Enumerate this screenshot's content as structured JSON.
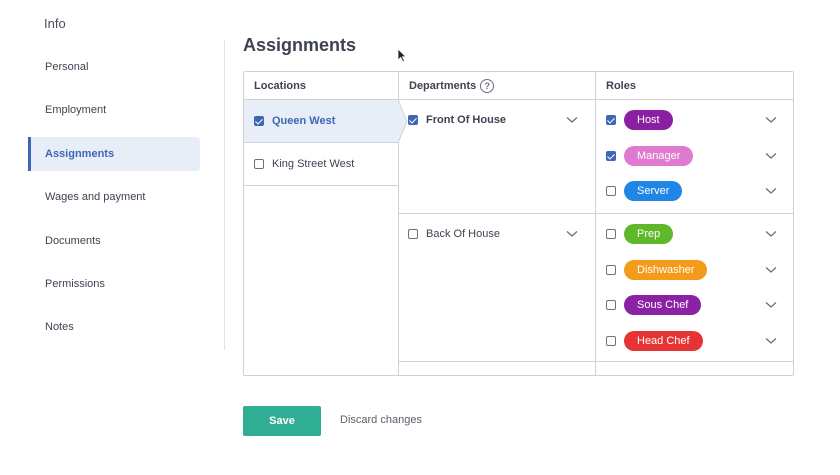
{
  "sidebar": {
    "title": "Info",
    "items": [
      {
        "label": "Personal",
        "active": false
      },
      {
        "label": "Employment",
        "active": false
      },
      {
        "label": "Assignments",
        "active": true
      },
      {
        "label": "Wages and payment",
        "active": false
      },
      {
        "label": "Documents",
        "active": false
      },
      {
        "label": "Permissions",
        "active": false
      },
      {
        "label": "Notes",
        "active": false
      }
    ]
  },
  "page": {
    "title": "Assignments"
  },
  "table": {
    "headers": {
      "locations": "Locations",
      "departments": "Departments",
      "help": "?",
      "roles": "Roles"
    },
    "locations": [
      {
        "label": "Queen West",
        "checked": true,
        "selected": true
      },
      {
        "label": "King Street West",
        "checked": false,
        "selected": false
      }
    ],
    "departments": [
      {
        "label": "Front Of House",
        "checked": true,
        "roles": [
          {
            "label": "Host",
            "checked": true,
            "color": "#8b1fa3"
          },
          {
            "label": "Manager",
            "checked": true,
            "color": "#e07ad0"
          },
          {
            "label": "Server",
            "checked": false,
            "color": "#1f86e6"
          }
        ]
      },
      {
        "label": "Back Of House",
        "checked": false,
        "roles": [
          {
            "label": "Prep",
            "checked": false,
            "color": "#5fb82a"
          },
          {
            "label": "Dishwasher",
            "checked": false,
            "color": "#f59b1c"
          },
          {
            "label": "Sous Chef",
            "checked": false,
            "color": "#8b22a3"
          },
          {
            "label": "Head Chef",
            "checked": false,
            "color": "#e63434"
          }
        ]
      }
    ]
  },
  "footer": {
    "save_label": "Save",
    "discard_label": "Discard changes"
  },
  "colors": {
    "accent": "#3b67b5",
    "save": "#2fae94"
  }
}
